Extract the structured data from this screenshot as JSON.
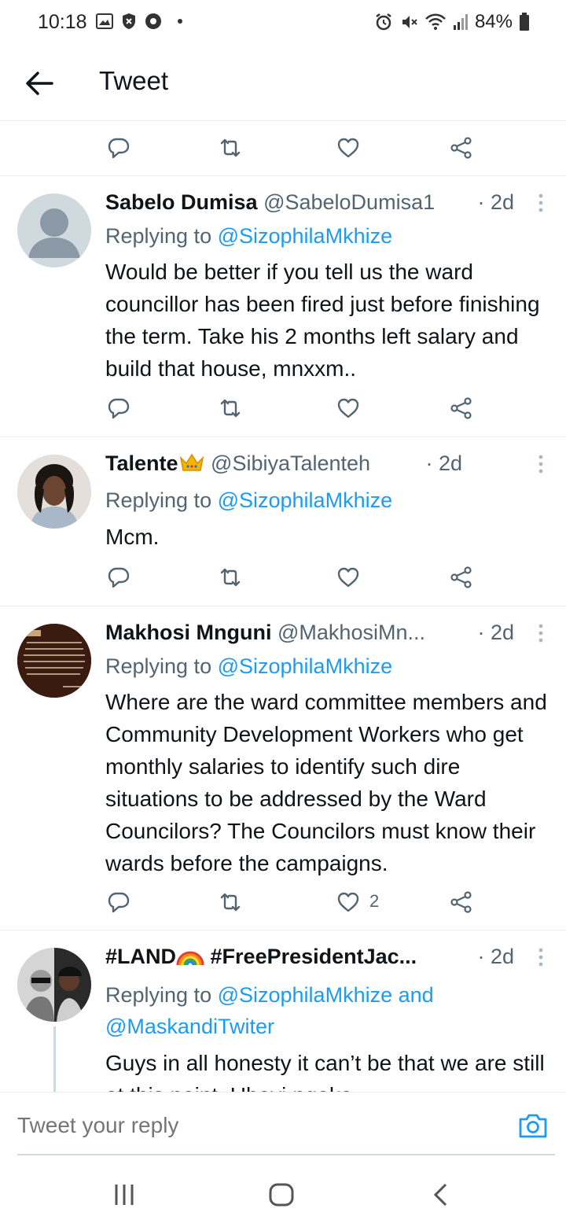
{
  "status_bar": {
    "time": "10:18",
    "battery": "84%"
  },
  "header": {
    "title": "Tweet"
  },
  "tweets": [
    {
      "name": "Sabelo Dumisa",
      "handle": "@SabeloDumisa1",
      "time": "· 2d",
      "replying_prefix": "Replying to ",
      "replying_to": "@SizophilaMkhize",
      "body": "Would be better if you tell us the ward councillor has been fired just before finishing the term. Take his 2 months left salary and build that house, mnxxm..",
      "likes": ""
    },
    {
      "name": "Talente",
      "handle": "@SibiyaTalenteh",
      "time": "· 2d",
      "replying_prefix": "Replying to ",
      "replying_to": "@SizophilaMkhize",
      "body": "Mcm.",
      "likes": ""
    },
    {
      "name": "Makhosi Mnguni",
      "handle": "@MakhosiMn...",
      "time": "· 2d",
      "replying_prefix": "Replying to ",
      "replying_to": "@SizophilaMkhize",
      "body": "Where are the ward committee members and Community Development Workers who get monthly salaries to identify such dire situations to be addressed by the Ward Councilors? The Councilors must know their wards before the campaigns.",
      "likes": "2"
    },
    {
      "name": "#LAND",
      "name_suffix": "#FreePresidentJac...",
      "time": "· 2d",
      "replying_prefix": "Replying to ",
      "replying_to": "@SizophilaMkhize and",
      "replying_to_2": "@MaskandiTwiter",
      "body": "Guys in all honesty it can’t be that we are still at this point. Ubayi ngaka"
    }
  ],
  "reply_bar": {
    "placeholder": "Tweet your reply"
  },
  "colors": {
    "accent": "#1d9bf0",
    "secondary_text": "#536471",
    "divider": "#e6ecf0"
  }
}
